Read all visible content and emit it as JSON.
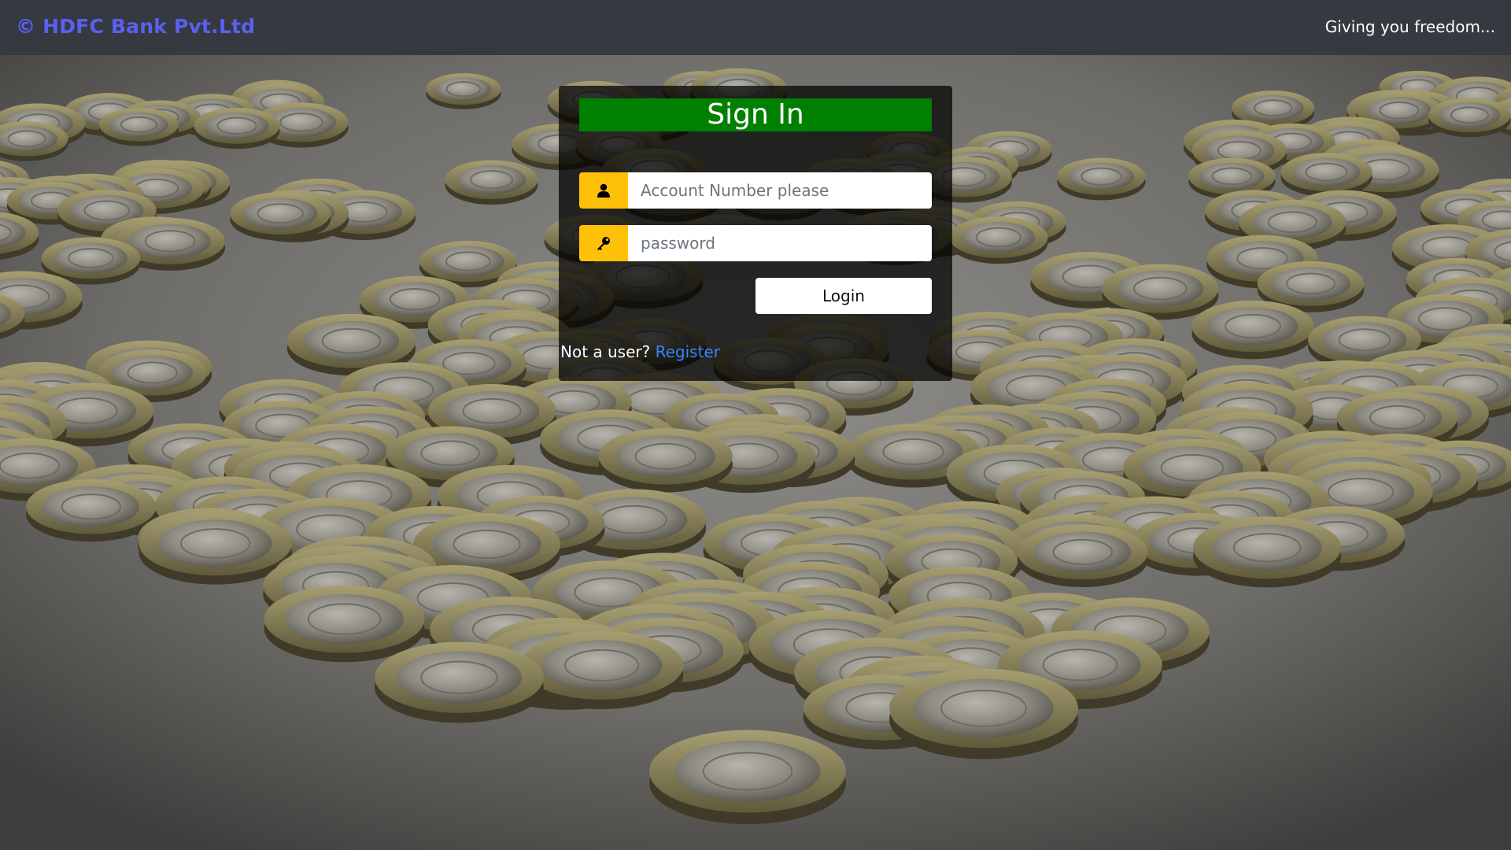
{
  "navbar": {
    "brand": "© HDFC Bank Pvt.Ltd",
    "tagline": "Giving you freedom..."
  },
  "login": {
    "title": "Sign In",
    "account_placeholder": "Account Number please",
    "password_placeholder": "password",
    "account_icon": "user-icon",
    "password_icon": "key-icon",
    "submit_label": "Login",
    "register_prompt": "Not a user?",
    "register_link": "Register"
  },
  "colors": {
    "navbar_bg": "#343a40",
    "brand": "#5b5ff0",
    "title_bg": "#008000",
    "icon_bg": "#ffc107",
    "link": "#3b82f6"
  }
}
